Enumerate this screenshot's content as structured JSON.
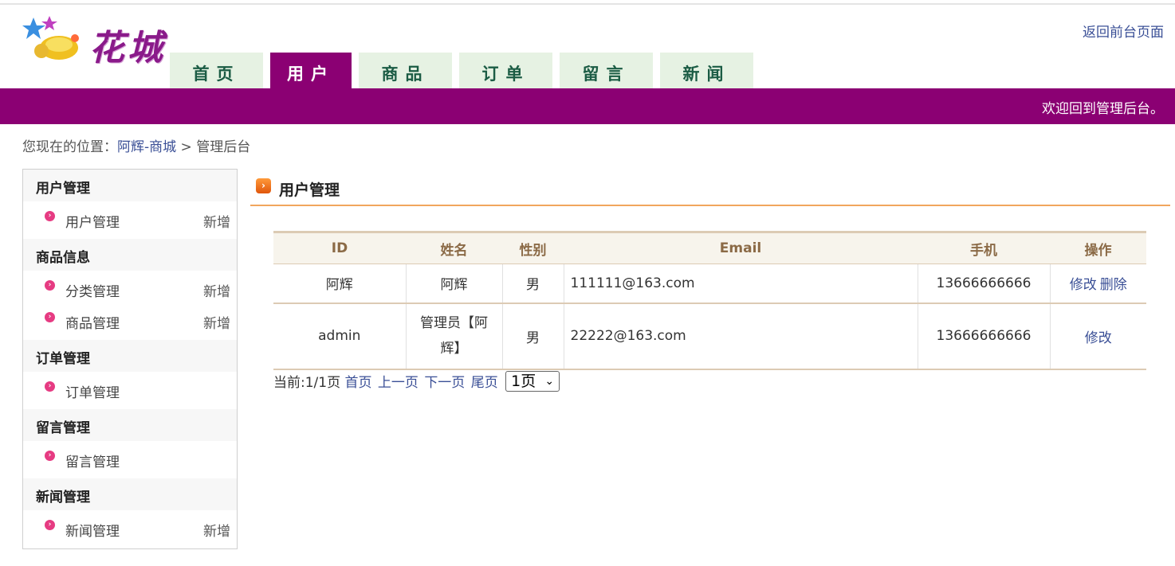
{
  "logo": {
    "text": "花城"
  },
  "nav": {
    "tabs": [
      {
        "label": "首页",
        "active": false
      },
      {
        "label": "用户",
        "active": true
      },
      {
        "label": "商品",
        "active": false
      },
      {
        "label": "订单",
        "active": false
      },
      {
        "label": "留言",
        "active": false
      },
      {
        "label": "新闻",
        "active": false
      }
    ],
    "return_link": "返回前台页面"
  },
  "banner": {
    "welcome": "欢迎回到管理后台。"
  },
  "breadcrumb": {
    "prefix": "您现在的位置：",
    "home": "阿辉-商城",
    "separator": ">",
    "current": "管理后台"
  },
  "sidebar": {
    "sections": [
      {
        "title": "用户管理",
        "items": [
          {
            "label": "用户管理",
            "add": "新增"
          }
        ]
      },
      {
        "title": "商品信息",
        "items": [
          {
            "label": "分类管理",
            "add": "新增"
          },
          {
            "label": "商品管理",
            "add": "新增"
          }
        ]
      },
      {
        "title": "订单管理",
        "items": [
          {
            "label": "订单管理",
            "add": ""
          }
        ]
      },
      {
        "title": "留言管理",
        "items": [
          {
            "label": "留言管理",
            "add": ""
          }
        ]
      },
      {
        "title": "新闻管理",
        "items": [
          {
            "label": "新闻管理",
            "add": "新增"
          }
        ]
      }
    ]
  },
  "main": {
    "title": "用户管理",
    "table": {
      "headers": [
        "ID",
        "姓名",
        "性别",
        "Email",
        "手机",
        "操作"
      ],
      "rows": [
        {
          "id": "阿辉",
          "name": "阿辉",
          "gender": "男",
          "email": "111111@163.com",
          "phone": "13666666666",
          "actions": [
            "修改",
            "删除"
          ]
        },
        {
          "id": "admin",
          "name": "管理员【阿辉】",
          "gender": "男",
          "email": "22222@163.com",
          "phone": "13666666666",
          "actions": [
            "修改"
          ]
        }
      ]
    },
    "pager": {
      "current": "当前:1/1页",
      "first": "首页",
      "prev": "上一页",
      "next": "下一页",
      "last": "尾页",
      "select_value": "1页"
    }
  },
  "colors": {
    "brand": "#8b0073",
    "tab_bg": "#e6f2e3",
    "accent_rule": "#f1a65e",
    "link": "#3a4f96"
  }
}
